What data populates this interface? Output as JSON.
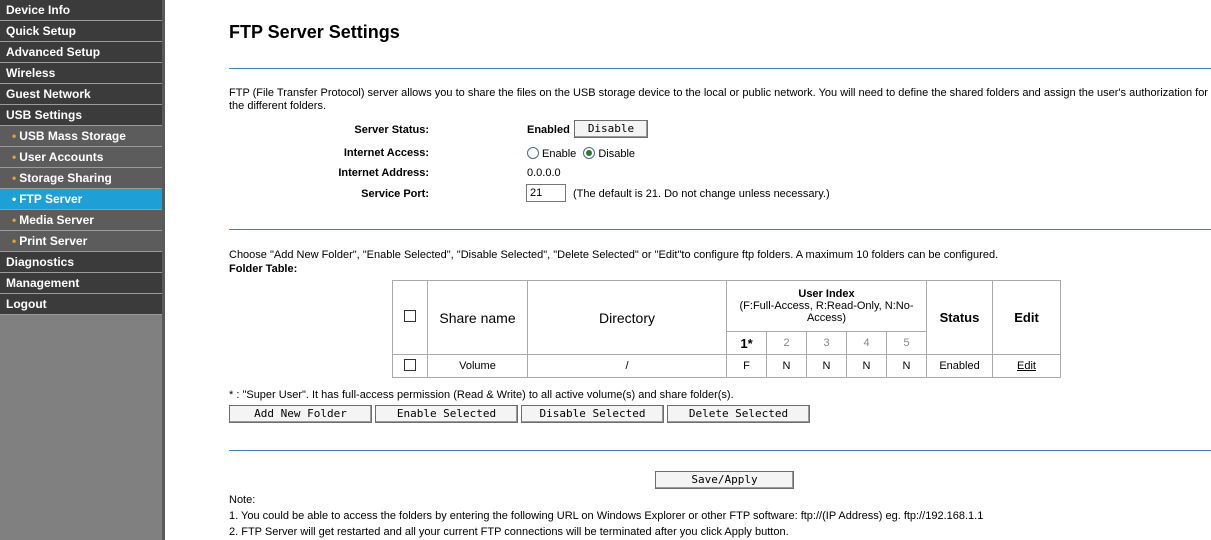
{
  "sidebar": {
    "items": [
      {
        "label": "Device Info"
      },
      {
        "label": "Quick Setup"
      },
      {
        "label": "Advanced Setup"
      },
      {
        "label": "Wireless"
      },
      {
        "label": "Guest Network"
      },
      {
        "label": "USB Settings"
      },
      {
        "label": "USB Mass Storage",
        "bullet": "•"
      },
      {
        "label": "User Accounts",
        "bullet": "•"
      },
      {
        "label": "Storage Sharing",
        "bullet": "•"
      },
      {
        "label": "FTP Server",
        "bullet": "•"
      },
      {
        "label": "Media Server",
        "bullet": "•"
      },
      {
        "label": "Print Server",
        "bullet": "•"
      },
      {
        "label": "Diagnostics"
      },
      {
        "label": "Management"
      },
      {
        "label": "Logout"
      }
    ]
  },
  "page": {
    "title": "FTP Server Settings",
    "description": "FTP (File Transfer Protocol) server allows you to share the files on the USB storage device to the local or public network. You will need to define the shared folders and assign the user's authorization for the different folders."
  },
  "form": {
    "server_status_label": "Server Status:",
    "server_status_value": "Enabled",
    "disable_button": "Disable",
    "internet_access_label": "Internet Access:",
    "enable_option": "Enable",
    "disable_option": "Disable",
    "internet_access_selected": "Disable",
    "internet_address_label": "Internet Address:",
    "internet_address_value": "0.0.0.0",
    "service_port_label": "Service Port:",
    "service_port_value": "21",
    "service_port_hint": "(The default is 21. Do not change unless necessary.)"
  },
  "folders": {
    "instructions": "Choose \"Add New Folder\", \"Enable Selected\", \"Disable Selected\", \"Delete Selected\" or \"Edit\"to configure ftp folders. A maximum 10 folders can be configured.",
    "table_label": "Folder Table:",
    "headers": {
      "share_name": "Share name",
      "directory": "Directory",
      "user_index": "User Index",
      "user_index_sub": "(F:Full-Access, R:Read-Only, N:No-Access)",
      "status": "Status",
      "edit": "Edit",
      "user_numbers": [
        "1*",
        "2",
        "3",
        "4",
        "5"
      ]
    },
    "rows": [
      {
        "share_name": "Volume",
        "directory": "/",
        "users": [
          "F",
          "N",
          "N",
          "N",
          "N"
        ],
        "status": "Enabled",
        "edit": "Edit"
      }
    ],
    "super_user_note": "* : \"Super User\". It has full-access permission (Read & Write) to all active volume(s) and share folder(s).",
    "buttons": {
      "add": "Add New Folder",
      "enable": "Enable Selected",
      "disable": "Disable Selected",
      "delete": "Delete Selected"
    }
  },
  "save_button": "Save/Apply",
  "notes": {
    "title": "Note:",
    "line1": "1. You could be able to access the folders by entering the following URL on Windows Explorer or other FTP software: ftp://(IP Address) eg. ftp://192.168.1.1",
    "line2": "2. FTP Server will get restarted and all your current FTP connections will be terminated after you click Apply button."
  }
}
